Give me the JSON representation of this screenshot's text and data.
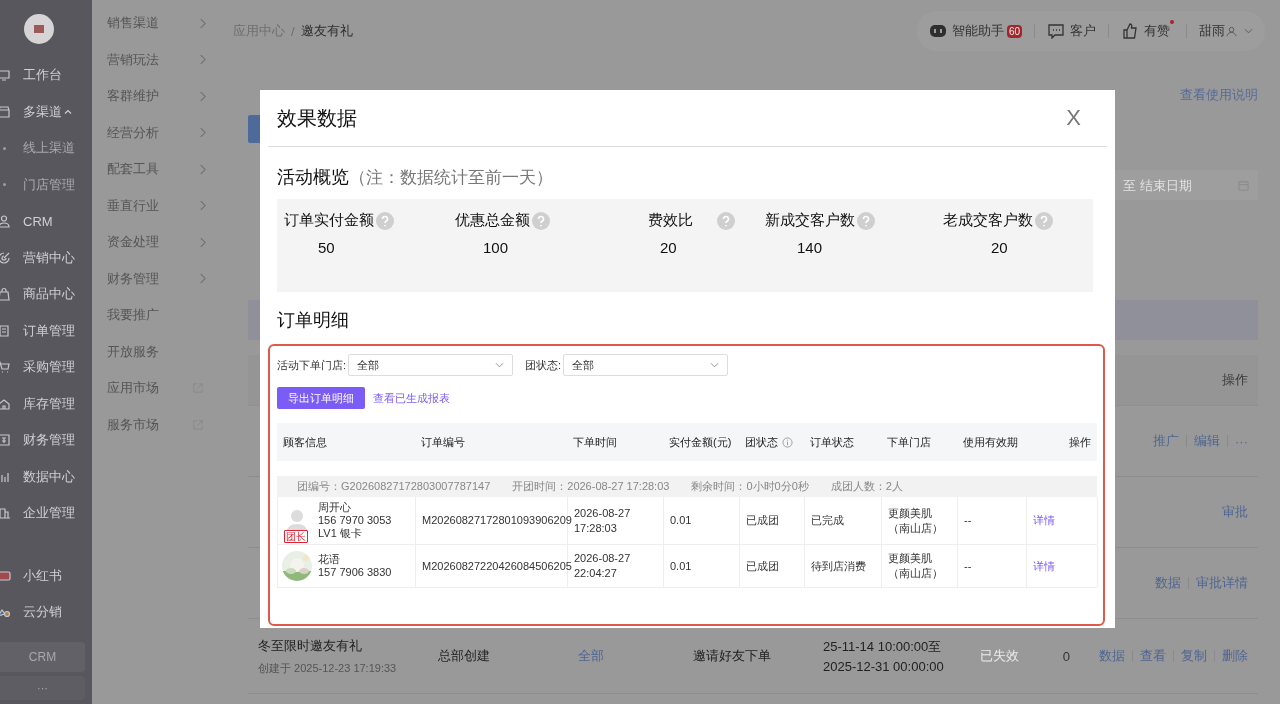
{
  "sidebar": {
    "items": [
      {
        "label": "工作台",
        "kind": "main",
        "expanded": false
      },
      {
        "label": "多渠道",
        "kind": "main",
        "expanded": true
      },
      {
        "label": "线上渠道",
        "kind": "sub"
      },
      {
        "label": "门店管理",
        "kind": "sub"
      },
      {
        "label": "CRM",
        "kind": "main",
        "expanded": false
      },
      {
        "label": "营销中心",
        "kind": "main",
        "expanded": false
      },
      {
        "label": "商品中心",
        "kind": "main",
        "expanded": false
      },
      {
        "label": "订单管理",
        "kind": "main",
        "expanded": false
      },
      {
        "label": "采购管理",
        "kind": "main",
        "expanded": false
      },
      {
        "label": "库存管理",
        "kind": "main",
        "expanded": false
      },
      {
        "label": "财务管理",
        "kind": "main",
        "expanded": false
      },
      {
        "label": "数据中心",
        "kind": "main",
        "expanded": false
      },
      {
        "label": "企业管理",
        "kind": "main",
        "expanded": false
      },
      {
        "label": "小红书",
        "kind": "app"
      },
      {
        "label": "云分销",
        "kind": "app"
      }
    ],
    "crm_button": "CRM",
    "more": "···"
  },
  "submenu": {
    "items": [
      {
        "label": "销售渠道",
        "kind": "folder"
      },
      {
        "label": "营销玩法",
        "kind": "folder"
      },
      {
        "label": "客群维护",
        "kind": "folder"
      },
      {
        "label": "经营分析",
        "kind": "folder"
      },
      {
        "label": "配套工具",
        "kind": "folder"
      },
      {
        "label": "垂直行业",
        "kind": "folder"
      },
      {
        "label": "资金处理",
        "kind": "folder"
      },
      {
        "label": "财务管理",
        "kind": "folder"
      },
      {
        "label": "我要推广",
        "kind": "plain"
      },
      {
        "label": "开放服务",
        "kind": "plain"
      },
      {
        "label": "应用市场",
        "kind": "external"
      },
      {
        "label": "服务市场",
        "kind": "external"
      }
    ]
  },
  "topbar": {
    "breadcrumb": [
      "应用中心",
      "邀友有礼"
    ],
    "breadcrumb_separator": "/",
    "assistant": {
      "label": "智能助手",
      "badge": "60"
    },
    "customer": "客户",
    "brand": {
      "label": "有赞",
      "dot": true
    },
    "user": "甜雨"
  },
  "page": {
    "help_link": "查看使用说明",
    "end_date": {
      "placeholder": "至 结束日期"
    },
    "actions_header": "操作",
    "rows": [
      {
        "actions": [
          "推广",
          "编辑",
          "···"
        ]
      },
      {
        "actions": [
          "审批"
        ]
      },
      {
        "actions": [
          "数据",
          "审批详情"
        ]
      },
      {
        "name": "冬至限时邀友有礼",
        "created": "创建于 2025-12-23 17:19:33",
        "source": "总部创建",
        "scope": "全部",
        "type": "邀请好友下单",
        "period": [
          "25-11-14 10:00:00至",
          "2025-12-31 00:00:00"
        ],
        "status": "已失效",
        "count": "0",
        "actions": [
          "数据",
          "查看",
          "复制",
          "删除"
        ]
      }
    ]
  },
  "modal": {
    "title": "效果数据",
    "close": "X",
    "overview_title": "活动概览",
    "overview_note": "（注：数据统计至前一天）",
    "stats": [
      {
        "label": "订单实付金额",
        "value": "50"
      },
      {
        "label": "优惠总金额",
        "value": "100"
      },
      {
        "label": "费效比",
        "value": "20"
      },
      {
        "label": "新成交客户数",
        "value": "140"
      },
      {
        "label": "老成交客户数",
        "value": "20"
      }
    ],
    "detail_title": "订单明细",
    "filters": [
      {
        "label": "活动下单门店:",
        "value": "全部"
      },
      {
        "label": "团状态:",
        "value": "全部"
      }
    ],
    "export_button": "导出订单明细",
    "report_link": "查看已生成报表",
    "columns": [
      {
        "label": "顾客信息",
        "info": false
      },
      {
        "label": "订单编号",
        "info": false
      },
      {
        "label": "下单时间",
        "info": false
      },
      {
        "label": "实付金额(元)",
        "info": false
      },
      {
        "label": "团状态",
        "info": true
      },
      {
        "label": "订单状态",
        "info": false
      },
      {
        "label": "下单门店",
        "info": false
      },
      {
        "label": "使用有效期",
        "info": false
      },
      {
        "label": "操作",
        "info": false
      }
    ],
    "group": [
      "团编号：G20260827172803007787147",
      "开团时间：2026-08-27 17:28:03",
      "剩余时间：0小时0分0秒",
      "成团人数：2人"
    ],
    "rows": [
      {
        "avatar": {
          "kind": "silhouette"
        },
        "tag": "团长",
        "customer": [
          "周开心",
          "156 7970 3053",
          "LV1 银卡"
        ],
        "order_no": "M20260827172801093906209",
        "time": "2026-08-27 17:28:03",
        "amount": "0.01",
        "group_status": "已成团",
        "order_status": "已完成",
        "store": "更颜美肌（南山店）",
        "validity": "--",
        "action": "详情"
      },
      {
        "avatar": {
          "kind": "picture"
        },
        "customer": [
          "花语",
          "157 7906 3830"
        ],
        "order_no": "M20260827220426084506205",
        "time": "2026-08-27 22:04:27",
        "amount": "0.01",
        "group_status": "已成团",
        "order_status": "待到店消费",
        "store": "更颜美肌（南山店）",
        "validity": "--",
        "action": "详情"
      }
    ]
  }
}
